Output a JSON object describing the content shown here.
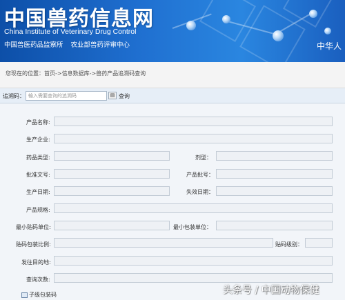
{
  "header": {
    "title": "中国兽药信息网",
    "title_en": "China Institute of Veterinary Drug Control",
    "org": "中国兽医药品监察所 农业部兽药评审中心",
    "right_text": "中华人"
  },
  "breadcrumb": {
    "text": "您现在的位置：首页->信息数据库->兽药产品追溯码查询"
  },
  "search": {
    "label": "追溯码：",
    "placeholder": "输入需要查询的追溯码",
    "button_label": "查询"
  },
  "form": {
    "product_name": "产品名称:",
    "manufacturer": "生产企业:",
    "drug_type": "药品类型:",
    "dosage_form": "剂型：",
    "approval_no": "批准文号:",
    "batch_no": "产品批号：",
    "production_date": "生产日期:",
    "expiry_date": "失效日期：",
    "specification": "产品规格:",
    "min_code_unit": "最小贴码单位:",
    "min_pack_unit": "最小包装单位：",
    "code_pack_ratio": "贴码包装比例:",
    "code_level": "贴码级别：",
    "destination": "发往目的地:",
    "query_count": "查询次数:"
  },
  "sub_code": {
    "label": "子级包装码"
  },
  "watermark": "头条号 / 中国动物保健"
}
